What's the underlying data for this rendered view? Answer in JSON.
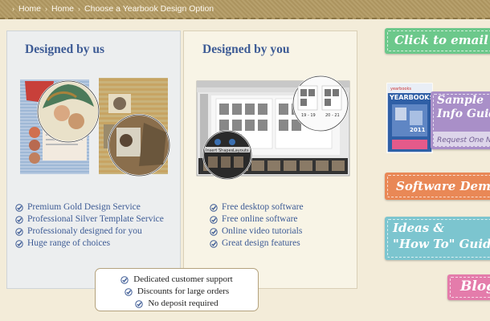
{
  "breadcrumb": {
    "items": [
      "Home",
      "Home",
      "Choose a Yearbook Design Option"
    ]
  },
  "panels": {
    "us": {
      "title": "Designed by us",
      "features": [
        "Premium Gold Design Service",
        "Professional Silver Template Service",
        "Professionaly designed for you",
        "Huge range of choices"
      ]
    },
    "you": {
      "title": "Designed by you",
      "features": [
        "Free desktop software",
        "Free online software",
        "Online video tutorials",
        "Great design features"
      ],
      "screenshot": {
        "zoom_left_labels": [
          "Insert",
          "Shapes",
          "Layouts"
        ],
        "zoom_right_labels": [
          "19 - 19",
          "20 - 21"
        ]
      }
    }
  },
  "bottom_box": {
    "items": [
      "Dedicated customer support",
      "Discounts for large orders",
      "No deposit required"
    ]
  },
  "sidebar": {
    "email": "Click to email us",
    "sample_title_1": "Sample",
    "sample_title_2": "Info Guide",
    "sample_sub": "Request One Now",
    "book_brand": "yearbooks",
    "book_title": "YEARBOOKS",
    "book_year": "2011",
    "demo": "Software Demo",
    "guide_1": "Ideas &",
    "guide_2": "\"How To\" Guide",
    "blog": "Blog"
  },
  "colors": {
    "title_blue": "#3d5b95",
    "bar_tan": "#b39a63",
    "btn_green": "#6cc88b",
    "btn_orange": "#e98856",
    "btn_teal": "#7cc5cf",
    "btn_pink": "#e47cab",
    "btn_purple": "#a98fc8"
  }
}
